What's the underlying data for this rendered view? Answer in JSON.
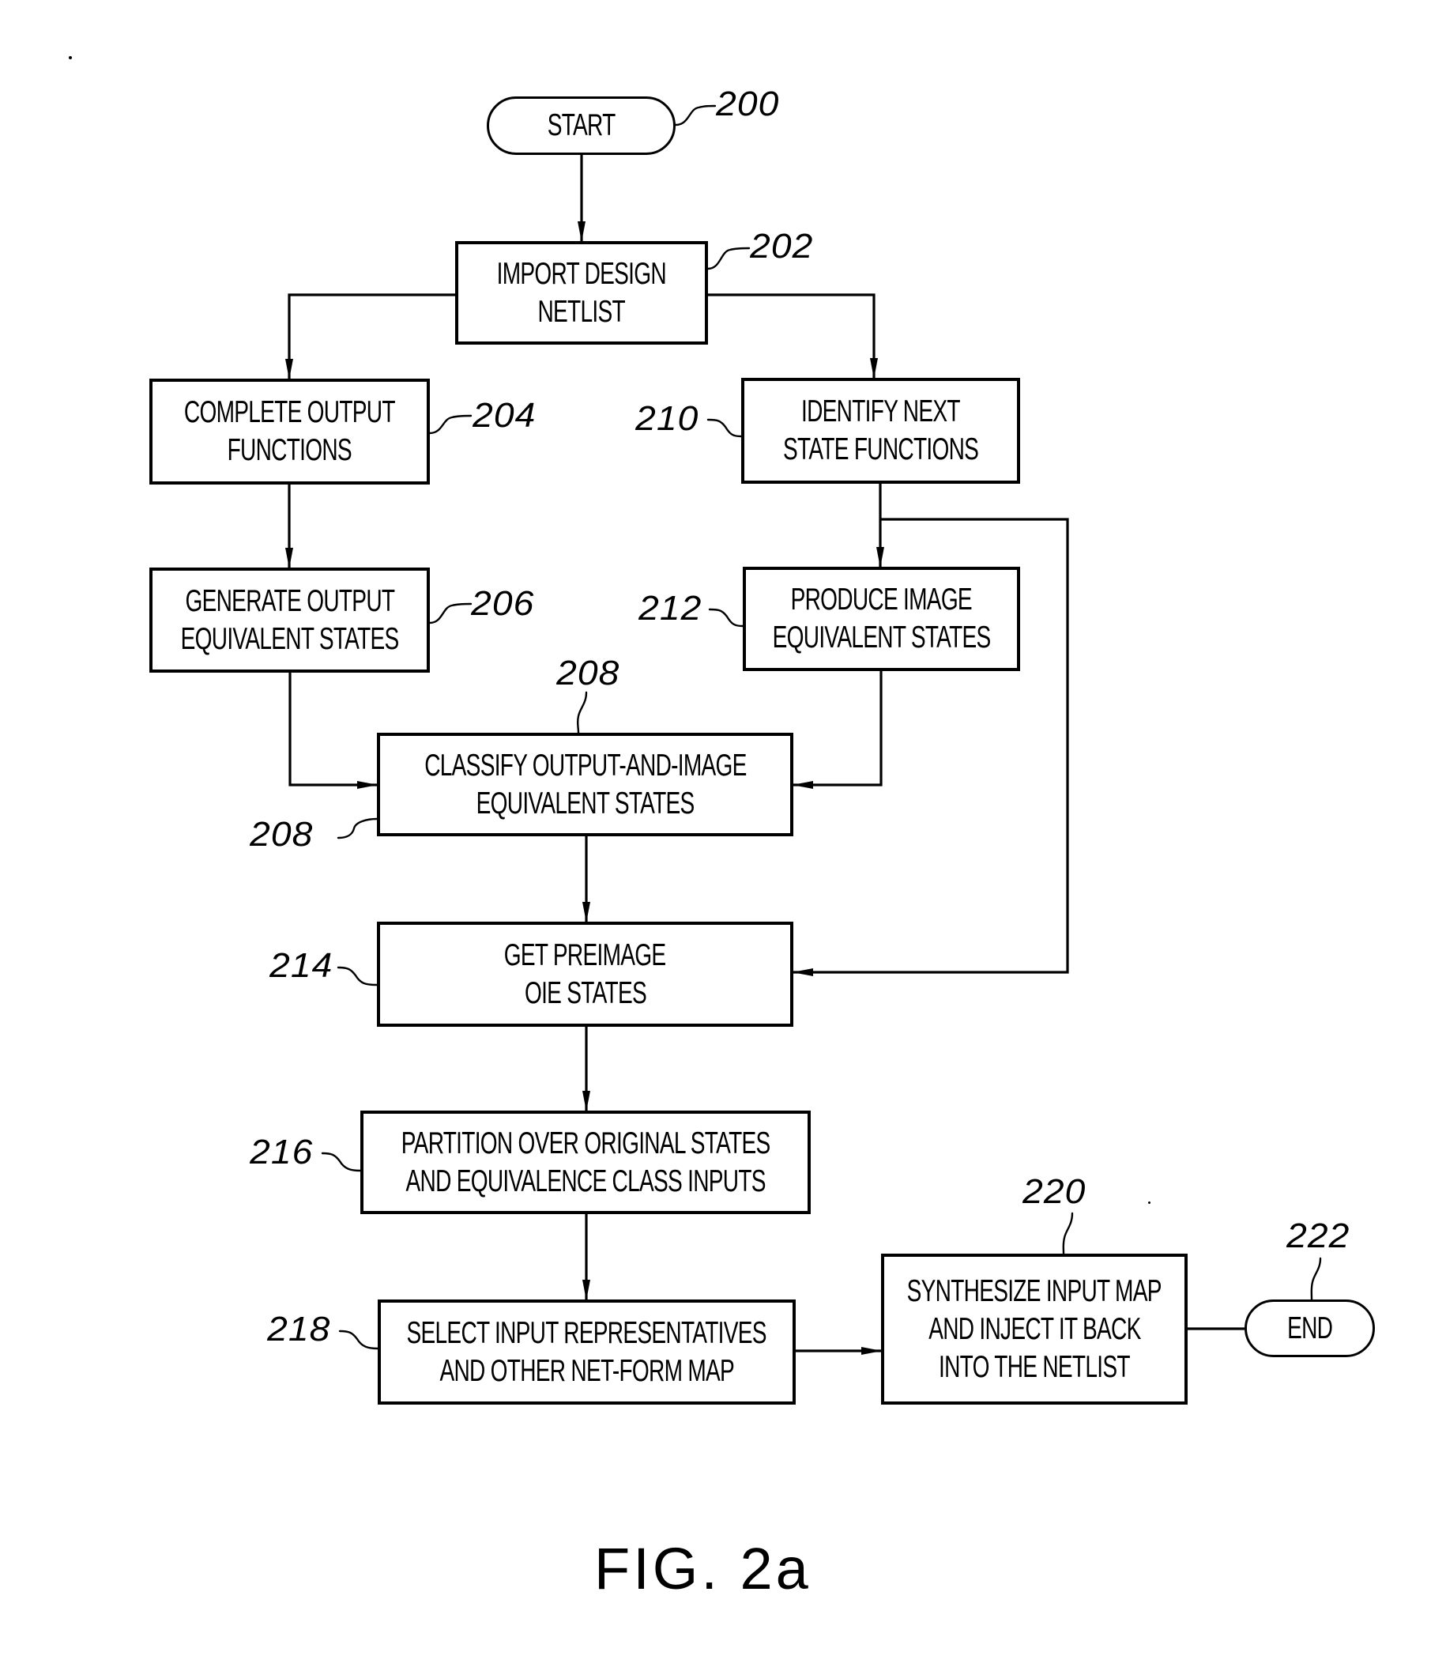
{
  "figure": {
    "label": "FIG. 2a",
    "type": "flowchart"
  },
  "nodes": {
    "n200": {
      "ref": "200",
      "shape": "terminal",
      "lines": [
        "START"
      ]
    },
    "n202": {
      "ref": "202",
      "shape": "process",
      "lines": [
        "IMPORT DESIGN",
        "NETLIST"
      ]
    },
    "n204": {
      "ref": "204",
      "shape": "process",
      "lines": [
        "COMPLETE OUTPUT",
        "FUNCTIONS"
      ]
    },
    "n206": {
      "ref": "206",
      "shape": "process",
      "lines": [
        "GENERATE OUTPUT",
        "EQUIVALENT STATES"
      ]
    },
    "n208": {
      "ref": "208",
      "ref_alt": "208",
      "shape": "process",
      "lines": [
        "CLASSIFY OUTPUT-AND-IMAGE",
        "EQUIVALENT STATES"
      ]
    },
    "n210": {
      "ref": "210",
      "shape": "process",
      "lines": [
        "IDENTIFY NEXT",
        "STATE FUNCTIONS"
      ]
    },
    "n212": {
      "ref": "212",
      "shape": "process",
      "lines": [
        "PRODUCE IMAGE",
        "EQUIVALENT STATES"
      ]
    },
    "n214": {
      "ref": "214",
      "shape": "process",
      "lines": [
        "GET PREIMAGE",
        "OIE STATES"
      ]
    },
    "n216": {
      "ref": "216",
      "shape": "process",
      "lines": [
        "PARTITION OVER ORIGINAL STATES",
        "AND EQUIVALENCE CLASS INPUTS"
      ]
    },
    "n218": {
      "ref": "218",
      "shape": "process",
      "lines": [
        "SELECT INPUT REPRESENTATIVES",
        "AND OTHER NET-FORM MAP"
      ]
    },
    "n220": {
      "ref": "220",
      "shape": "process",
      "lines": [
        "SYNTHESIZE INPUT MAP",
        "AND INJECT IT BACK",
        "INTO THE NETLIST"
      ]
    },
    "n222": {
      "ref": "222",
      "shape": "terminal",
      "lines": [
        "END"
      ]
    }
  },
  "edges": [
    {
      "from": "200",
      "to": "202"
    },
    {
      "from": "202",
      "to": "204"
    },
    {
      "from": "202",
      "to": "210"
    },
    {
      "from": "204",
      "to": "206"
    },
    {
      "from": "206",
      "to": "208"
    },
    {
      "from": "210",
      "to": "212"
    },
    {
      "from": "210",
      "to": "214"
    },
    {
      "from": "212",
      "to": "208"
    },
    {
      "from": "208",
      "to": "214"
    },
    {
      "from": "214",
      "to": "216"
    },
    {
      "from": "216",
      "to": "218"
    },
    {
      "from": "218",
      "to": "220"
    },
    {
      "from": "220",
      "to": "222",
      "arrow": false
    }
  ]
}
